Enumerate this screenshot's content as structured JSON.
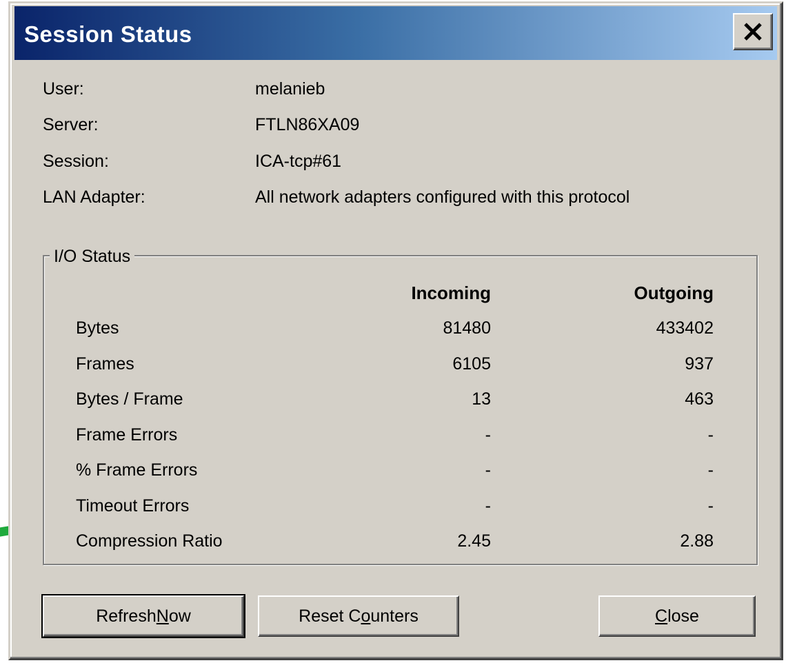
{
  "window": {
    "title": "Session Status",
    "close_glyph": "close-icon"
  },
  "info": {
    "user_label": "User:",
    "user_value": "melanieb",
    "server_label": "Server:",
    "server_value": "FTLN86XA09",
    "session_label": "Session:",
    "session_value": "ICA-tcp#61",
    "lan_label": "LAN Adapter:",
    "lan_value": "All network adapters configured with this protocol"
  },
  "io_status": {
    "title": "I/O Status",
    "col_incoming": "Incoming",
    "col_outgoing": "Outgoing",
    "rows": [
      {
        "label": "Bytes",
        "incoming": "81480",
        "outgoing": "433402"
      },
      {
        "label": "Frames",
        "incoming": "6105",
        "outgoing": "937"
      },
      {
        "label": "Bytes / Frame",
        "incoming": "13",
        "outgoing": "463"
      },
      {
        "label": "Frame Errors",
        "incoming": "-",
        "outgoing": "-"
      },
      {
        "label": "% Frame Errors",
        "incoming": "-",
        "outgoing": "-"
      },
      {
        "label": "Timeout Errors",
        "incoming": "-",
        "outgoing": "-"
      },
      {
        "label": "Compression Ratio",
        "incoming": "2.45",
        "outgoing": "2.88"
      }
    ]
  },
  "buttons": {
    "refresh_pre": "Refresh ",
    "refresh_key": "N",
    "refresh_post": "ow",
    "reset_pre": "Reset C",
    "reset_key": "o",
    "reset_post": "unters",
    "close_pre": "",
    "close_key": "C",
    "close_post": "lose"
  },
  "annotation": {
    "arrow_color": "#1faa3c"
  }
}
